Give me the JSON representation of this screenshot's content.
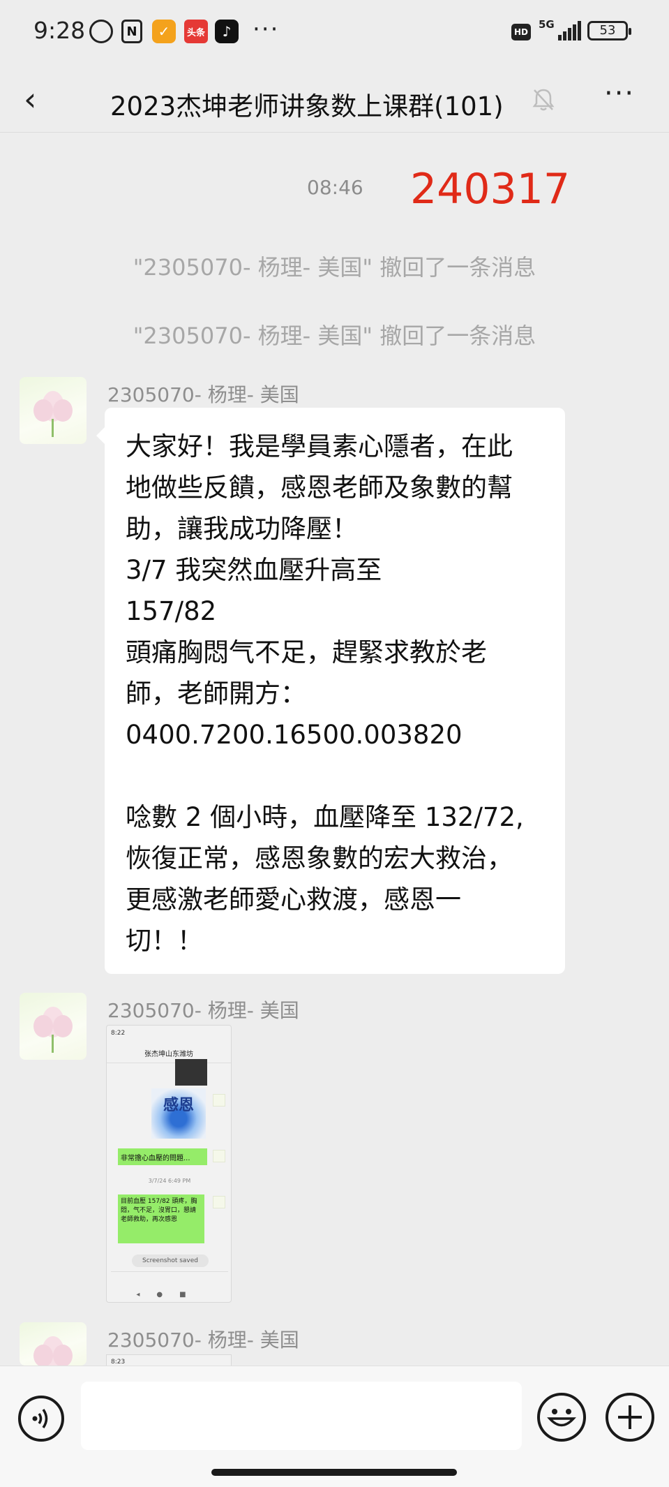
{
  "status_bar": {
    "time": "9:28",
    "app_icon_1": "头条",
    "network": "5G",
    "battery": "53"
  },
  "header": {
    "title": "2023杰坤老师讲象数上课群(101)"
  },
  "chat": {
    "timestamp": "08:46",
    "red_note": "240317",
    "recall_notices": [
      "\"2305070- 杨理- 美国\" 撤回了一条消息",
      "\"2305070- 杨理- 美国\" 撤回了一条消息"
    ],
    "messages": [
      {
        "sender": "2305070- 杨理- 美国",
        "lines": [
          "大家好！我是學員素心隱者，在此",
          "地做些反饋，感恩老師及象數的幫",
          "助，讓我成功降壓！",
          "3/7 我突然血壓升高至",
          "157/82",
          "頭痛胸悶气不足，趕緊求教於老",
          "師，老師開方：",
          "0400.7200.16500.003820",
          "",
          "唸數 2 個小時，血壓降至 132/72,",
          "恢復正常，感恩象數的宏大救治，",
          "更感激老師愛心救渡，感恩一",
          "切！！"
        ]
      },
      {
        "sender": "2305070- 杨理- 美国",
        "screenshot": {
          "status": "8:22",
          "title": "张杰坤山东潍坊",
          "image_text": "感恩",
          "green_msg_1": "非常擔心血壓的問題...",
          "date": "3/7/24 6:49 PM",
          "green_msg_2": "目前血壓 157/82 頭疼，胸悶，气不足，沒胃口，懇請老師救助，再次感恩",
          "saved_toast": "Screenshot saved"
        }
      },
      {
        "sender": "2305070- 杨理- 美国",
        "screenshot_status": "8:23"
      }
    ]
  },
  "icons": {
    "back": "chevron-left-icon",
    "mute": "bell-off-icon",
    "more": "more-icon",
    "voice": "voice-icon",
    "emoji": "emoji-icon",
    "plus": "plus-icon"
  }
}
